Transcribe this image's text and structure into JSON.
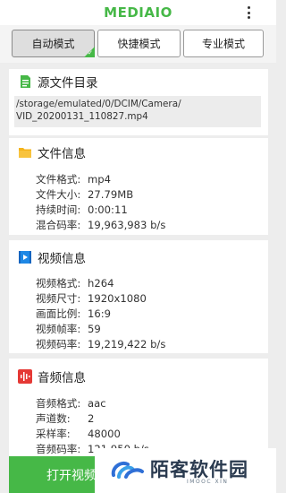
{
  "app": {
    "logo": "MEDIAIO"
  },
  "modes": [
    {
      "label": "自动模式",
      "active": true
    },
    {
      "label": "快捷模式",
      "active": false
    },
    {
      "label": "专业模式",
      "active": false
    }
  ],
  "source": {
    "title": "源文件目录",
    "path_lines": [
      "/storage/emulated/0/DCIM/Camera/",
      "VID_20200131_110827.mp4"
    ]
  },
  "file_info": {
    "title": "文件信息",
    "rows": [
      {
        "key": "文件格式:",
        "value": "mp4"
      },
      {
        "key": "文件大小:",
        "value": "27.79MB"
      },
      {
        "key": "持续时间:",
        "value": "0:00:11"
      },
      {
        "key": "混合码率:",
        "value": "19,963,983 b/s"
      }
    ]
  },
  "video_info": {
    "title": "视频信息",
    "rows": [
      {
        "key": "视频格式:",
        "value": "h264"
      },
      {
        "key": "视频尺寸:",
        "value": "1920x1080"
      },
      {
        "key": "画面比例:",
        "value": "16:9"
      },
      {
        "key": "视频帧率:",
        "value": "59"
      },
      {
        "key": "视频码率:",
        "value": "19,219,422 b/s"
      }
    ]
  },
  "audio_info": {
    "title": "音频信息",
    "rows": [
      {
        "key": "音频格式:",
        "value": "aac"
      },
      {
        "key": "声道数:",
        "value": "2"
      },
      {
        "key": "采样率:",
        "value": "48000"
      },
      {
        "key": "音频码率:",
        "value": "121,950 b/s"
      }
    ]
  },
  "open_button": {
    "label": "打开视频"
  },
  "watermark": {
    "text": "陌客软件园",
    "sub": "IMOOC XIN"
  },
  "colors": {
    "accent": "#46b847",
    "background": "#ededed",
    "panel": "#ffffff"
  }
}
